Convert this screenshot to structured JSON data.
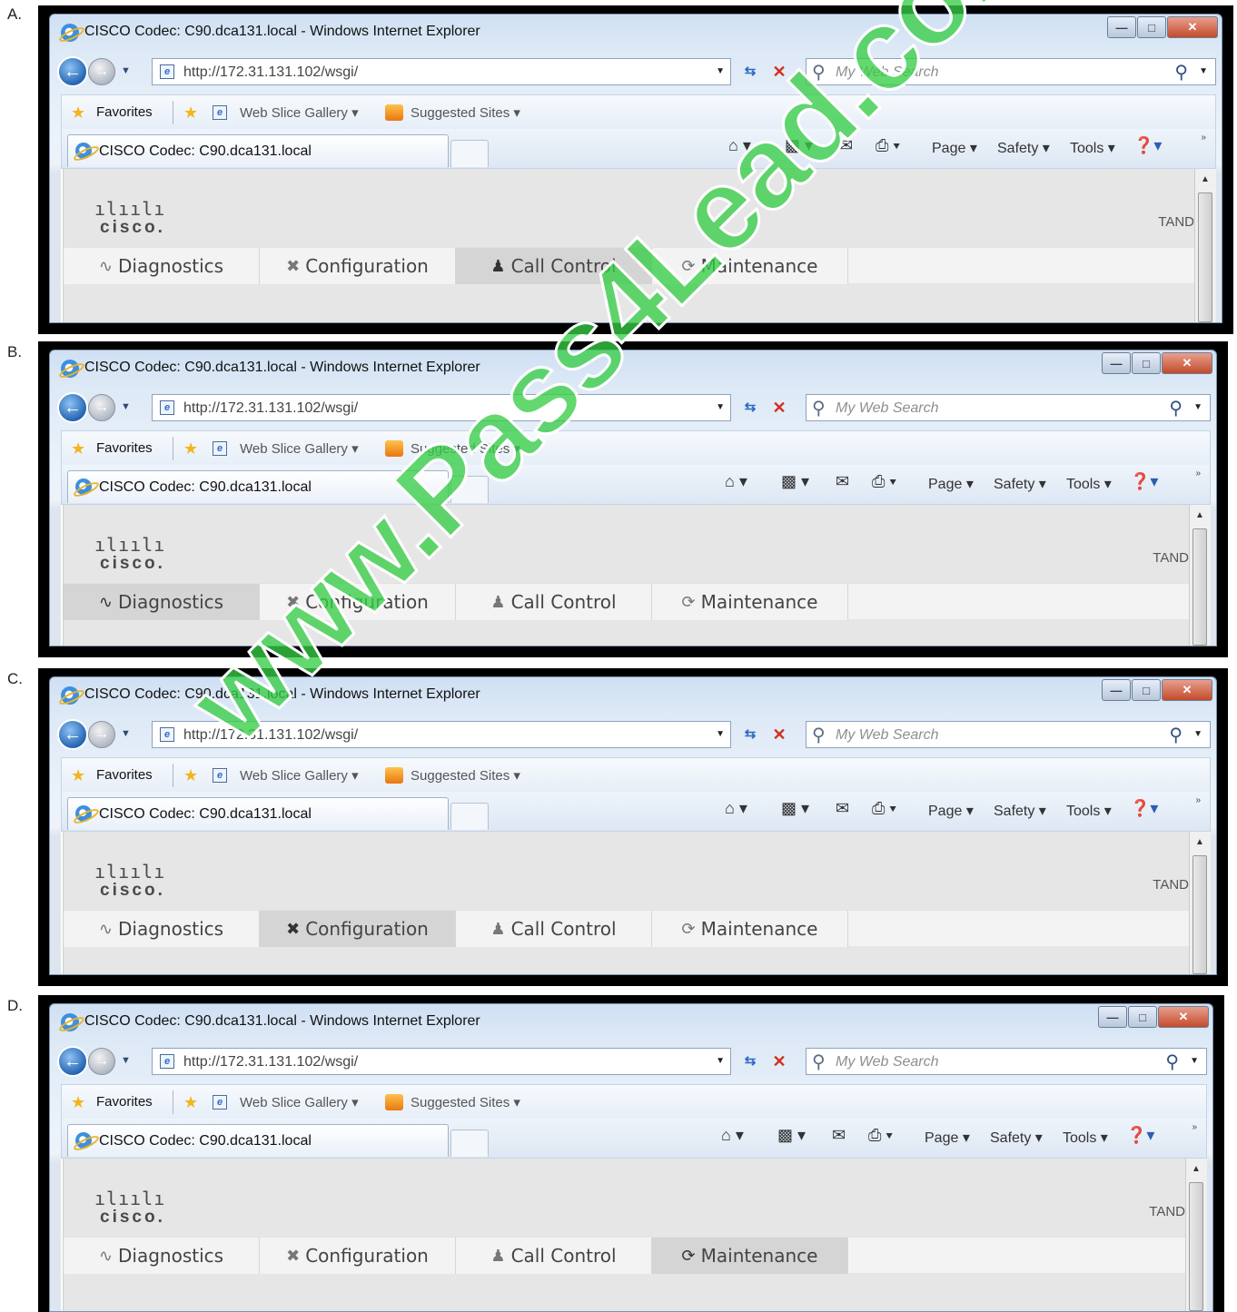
{
  "options": [
    {
      "letter": "A.",
      "window": {
        "title": "CISCO Codec: C90.dca131.local - Windows Internet Explorer",
        "url": "http://172.31.131.102/wsgi/",
        "search_placeholder": "My Web Search",
        "favorites": "Favorites",
        "web_slice_gallery": "Web Slice Gallery ▾",
        "suggested_sites": "Suggested Sites ▾",
        "tab_title": "CISCO Codec: C90.dca131.local",
        "cmd_page": "Page ▾",
        "cmd_safety": "Safety ▾",
        "cmd_tools": "Tools ▾"
      },
      "app": {
        "logo_text": "cisco.",
        "right_text": "TAND",
        "nav": [
          "Diagnostics",
          "Configuration",
          "Call Control",
          "Maintenance"
        ],
        "active_tab": "Call Control"
      }
    },
    {
      "letter": "B.",
      "window": {
        "title": "CISCO Codec: C90.dca131.local - Windows Internet Explorer",
        "url": "http://172.31.131.102/wsgi/",
        "search_placeholder": "My Web Search",
        "favorites": "Favorites",
        "web_slice_gallery": "Web Slice Gallery ▾",
        "suggested_sites": "Suggested Sites ▾",
        "tab_title": "CISCO Codec: C90.dca131.local",
        "cmd_page": "Page ▾",
        "cmd_safety": "Safety ▾",
        "cmd_tools": "Tools ▾"
      },
      "app": {
        "logo_text": "cisco.",
        "right_text": "TAND",
        "nav": [
          "Diagnostics",
          "Configuration",
          "Call Control",
          "Maintenance"
        ],
        "active_tab": "Diagnostics"
      }
    },
    {
      "letter": "C.",
      "window": {
        "title": "CISCO Codec: C90.dca131.local - Windows Internet Explorer",
        "url": "http://172.31.131.102/wsgi/",
        "search_placeholder": "My Web Search",
        "favorites": "Favorites",
        "web_slice_gallery": "Web Slice Gallery ▾",
        "suggested_sites": "Suggested Sites ▾",
        "tab_title": "CISCO Codec: C90.dca131.local",
        "cmd_page": "Page ▾",
        "cmd_safety": "Safety ▾",
        "cmd_tools": "Tools ▾"
      },
      "app": {
        "logo_text": "cisco.",
        "right_text": "TAND",
        "nav": [
          "Diagnostics",
          "Configuration",
          "Call Control",
          "Maintenance"
        ],
        "active_tab": "Configuration"
      }
    },
    {
      "letter": "D.",
      "window": {
        "title": "CISCO Codec: C90.dca131.local - Windows Internet Explorer",
        "url": "http://172.31.131.102/wsgi/",
        "search_placeholder": "My Web Search",
        "favorites": "Favorites",
        "web_slice_gallery": "Web Slice Gallery ▾",
        "suggested_sites": "Suggested Sites ▾",
        "tab_title": "CISCO Codec: C90.dca131.local",
        "cmd_page": "Page ▾",
        "cmd_safety": "Safety ▾",
        "cmd_tools": "Tools ▾"
      },
      "app": {
        "logo_text": "cisco.",
        "right_text": "TAND",
        "nav": [
          "Diagnostics",
          "Configuration",
          "Call Control",
          "Maintenance"
        ],
        "active_tab": "Maintenance"
      }
    }
  ],
  "watermark": "www.Pass4Lead.com",
  "icons": {
    "nav": [
      "diagnostics-pulse-icon",
      "wrench-screwdriver-icon",
      "people-icon",
      "refresh-cycle-icon"
    ]
  }
}
